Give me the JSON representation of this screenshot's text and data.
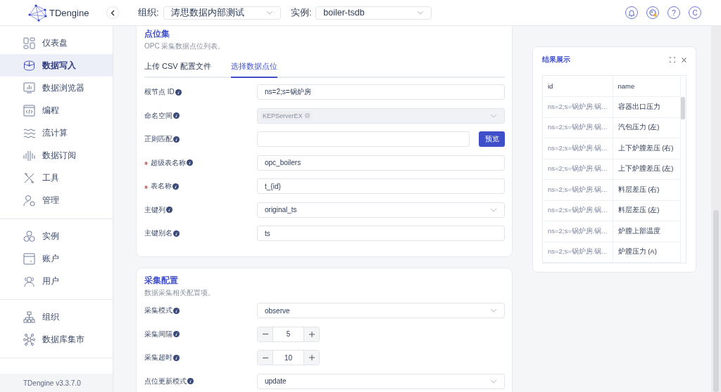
{
  "header": {
    "logo": "TDengine",
    "org_label": "组织:",
    "org_value": "涛思数据内部测试",
    "instance_label": "实例:",
    "instance_value": "boiler-tsdb",
    "help": "?",
    "avatar": "C"
  },
  "sidebar": {
    "groups": [
      {
        "items": [
          {
            "label": "仪表盘",
            "selected": false
          },
          {
            "label": "数据写入",
            "selected": true
          },
          {
            "label": "数据浏览器",
            "selected": false
          },
          {
            "label": "编程",
            "selected": false
          },
          {
            "label": "流计算",
            "selected": false
          },
          {
            "label": "数据订阅",
            "selected": false
          },
          {
            "label": "工具",
            "selected": false
          },
          {
            "label": "管理",
            "selected": false
          }
        ]
      },
      {
        "items": [
          {
            "label": "实例",
            "selected": false
          },
          {
            "label": "账户",
            "selected": false
          },
          {
            "label": "用户",
            "selected": false
          }
        ]
      },
      {
        "items": [
          {
            "label": "组织",
            "selected": false
          },
          {
            "label": "数据库集市",
            "selected": false
          }
        ]
      }
    ],
    "version": "TDengine v3.3.7.0"
  },
  "sections": [
    {
      "title": "点位集",
      "subtitle": "OPC 采集数据点位列表。",
      "tabs": [
        {
          "label": "上传 CSV 配置文件",
          "selected": false
        },
        {
          "label": "选择数据点位",
          "selected": true
        }
      ],
      "fields": [
        {
          "kind": "input",
          "label": "根节点 ID",
          "required": false,
          "disabled": false,
          "value": "ns=2;s=锅炉房"
        },
        {
          "kind": "select",
          "label": "命名空间",
          "required": false,
          "disabled": true,
          "tag": "KEPServerEX"
        },
        {
          "kind": "input_button",
          "label": "正则匹配",
          "required": false,
          "disabled": false,
          "button": "预览"
        },
        {
          "kind": "input",
          "label": "超级表名称",
          "required": true,
          "disabled": false,
          "value": "opc_boilers"
        },
        {
          "kind": "input",
          "label": "表名称",
          "required": true,
          "disabled": false,
          "value": "t_{id}"
        },
        {
          "kind": "select",
          "label": "主键列",
          "required": false,
          "disabled": false,
          "value": "original_ts"
        },
        {
          "kind": "input",
          "label": "主键别名",
          "required": false,
          "disabled": false,
          "value": "ts"
        }
      ]
    },
    {
      "title": "采集配置",
      "subtitle": "数据采集相关配置项。",
      "fields": [
        {
          "kind": "select",
          "label": "采集模式",
          "required": false,
          "disabled": false,
          "value": "observe"
        },
        {
          "kind": "stepper",
          "label": "采集间隔",
          "required": false,
          "disabled": false,
          "value": "5"
        },
        {
          "kind": "stepper",
          "label": "采集超时",
          "required": false,
          "disabled": false,
          "value": "10"
        },
        {
          "kind": "select",
          "label": "点位更新模式",
          "required": false,
          "disabled": false,
          "value": "update"
        }
      ]
    }
  ],
  "results": {
    "title": "结果展示",
    "columns": [
      "id",
      "name"
    ],
    "rows": [
      [
        "ns=2;s=锅炉房.锅...",
        "容器出口压力"
      ],
      [
        "ns=2;s=锅炉房.锅...",
        "汽包压力 (左)"
      ],
      [
        "ns=2;s=锅炉房.锅...",
        "上下炉膛差压 (右)"
      ],
      [
        "ns=2;s=锅炉房.锅...",
        "上下炉膛差压 (左)"
      ],
      [
        "ns=2;s=锅炉房.锅...",
        "料层差压 (右)"
      ],
      [
        "ns=2;s=锅炉房.锅...",
        "料层差压 (左)"
      ],
      [
        "ns=2;s=锅炉房.锅...",
        "炉膛上部温度"
      ],
      [
        "ns=2;s=锅炉房.锅...",
        "炉膛压力 (A)"
      ]
    ]
  }
}
